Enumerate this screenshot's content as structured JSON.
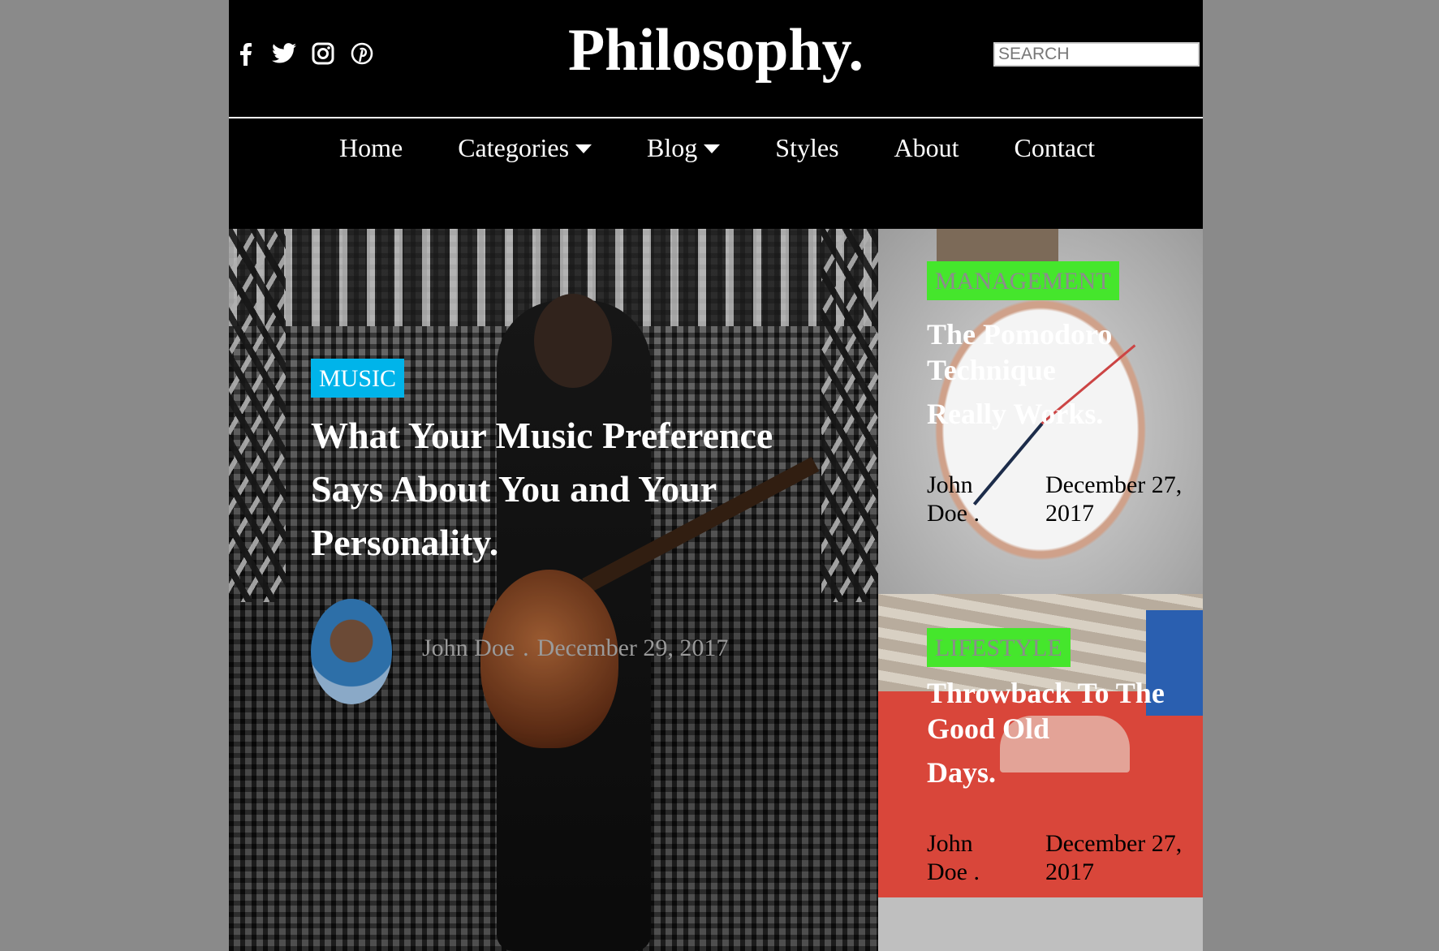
{
  "header": {
    "social": [
      {
        "icon": "facebook-icon"
      },
      {
        "icon": "twitter-icon"
      },
      {
        "icon": "instagram-icon"
      },
      {
        "icon": "pinterest-icon"
      }
    ],
    "site_title": "Philosophy.",
    "search_placeholder": "SEARCH"
  },
  "nav": {
    "items": [
      {
        "label": "Home"
      },
      {
        "label": "Categories",
        "has_dropdown": true
      },
      {
        "label": "Blog",
        "has_dropdown": true
      },
      {
        "label": "Styles"
      },
      {
        "label": "About"
      },
      {
        "label": "Contact"
      }
    ]
  },
  "hero": {
    "category": "MUSIC",
    "title": "What Your Music Preference Says About You and Your Personality.",
    "author": "John Doe",
    "separator": ".",
    "date": "December 29, 2017",
    "badge_color": "#00b4ea"
  },
  "cards": [
    {
      "category": "MANAGEMENT",
      "title_lines": [
        "The Pomodoro",
        "Technique",
        "Really Works."
      ],
      "author": "John Doe .",
      "date": "December 27, 2017"
    },
    {
      "category": "LIFESTYLE",
      "title_lines": [
        "Throwback To The",
        "Good Old",
        "Days."
      ],
      "author": "John Doe .",
      "date": "December 27, 2017"
    }
  ],
  "colors": {
    "page_bg": "#8a8a8a",
    "header_bg": "#000000",
    "card_badge": "#45e62c"
  }
}
